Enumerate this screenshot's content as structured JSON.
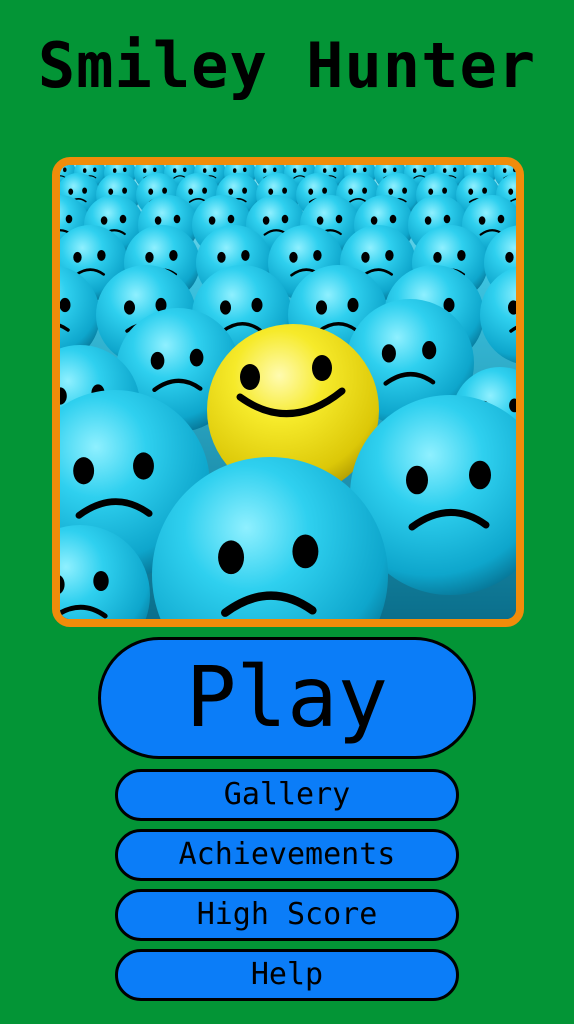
{
  "game": {
    "title": "Smiley Hunter"
  },
  "hero_image": {
    "description_icon": "crowd-of-sad-blue-smileys-with-one-happy-yellow-smiley"
  },
  "menu": {
    "play_label": "Play",
    "gallery_label": "Gallery",
    "achievements_label": "Achievements",
    "high_score_label": "High Score",
    "help_label": "Help"
  },
  "colors": {
    "background": "#039536",
    "frame": "#f08c0a",
    "button": "#0b7df8",
    "sad_smiley": "#1fc4e6",
    "happy_smiley": "#f2e21a"
  }
}
